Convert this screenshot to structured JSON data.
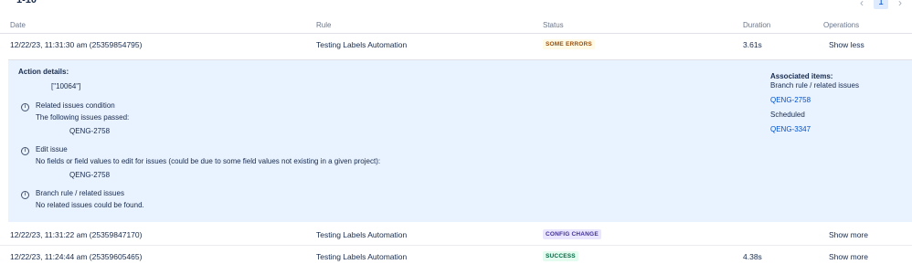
{
  "pagination": {
    "range": "1-10",
    "current_page": "1",
    "prev_icon": "chevron-left-icon",
    "next_icon": "chevron-right-icon"
  },
  "table": {
    "headers": {
      "date": "Date",
      "rule": "Rule",
      "status": "Status",
      "duration": "Duration",
      "operations": "Operations"
    },
    "rows": [
      {
        "date": "12/22/23, 11:31:30 am (25359854795)",
        "rule": "Testing Labels Automation",
        "status": "SOME ERRORS",
        "duration": "3.61s",
        "operation": "Show less"
      },
      {
        "date": "12/22/23, 11:31:22 am (25359847170)",
        "rule": "Testing Labels Automation",
        "status": "CONFIG CHANGE",
        "duration": "",
        "operation": "Show more"
      },
      {
        "date": "12/22/23, 11:24:44 am (25359605465)",
        "rule": "Testing Labels Automation",
        "status": "SUCCESS",
        "duration": "4.38s",
        "operation": "Show more"
      }
    ]
  },
  "details": {
    "action_title": "Action details:",
    "action_value": "[\"10064\"]",
    "steps": [
      {
        "icon": "info-icon",
        "title": "Related issues condition",
        "line": "The following issues passed:",
        "issue": "QENG-2758"
      },
      {
        "icon": "info-icon",
        "title": "Edit issue",
        "line": "No fields or field values to edit for issues (could be due to some field values not existing in a given project):",
        "issue": "QENG-2758"
      },
      {
        "icon": "info-icon",
        "title": "Branch rule / related issues",
        "line": "No related issues could be found.",
        "issue": ""
      }
    ],
    "associated": {
      "title": "Associated items:",
      "subtitle": "Branch rule / related issues",
      "link1": "QENG-2758",
      "scheduled": "Scheduled",
      "link2": "QENG-3347"
    }
  },
  "colors": {
    "details_bg": "#e9f2ff",
    "link": "#0052cc",
    "warn_text": "#974f0c",
    "warn_bg": "#fffae6",
    "config_text": "#403294",
    "config_bg": "#eae6ff",
    "success_text": "#006644",
    "success_bg": "#e3fcef"
  }
}
